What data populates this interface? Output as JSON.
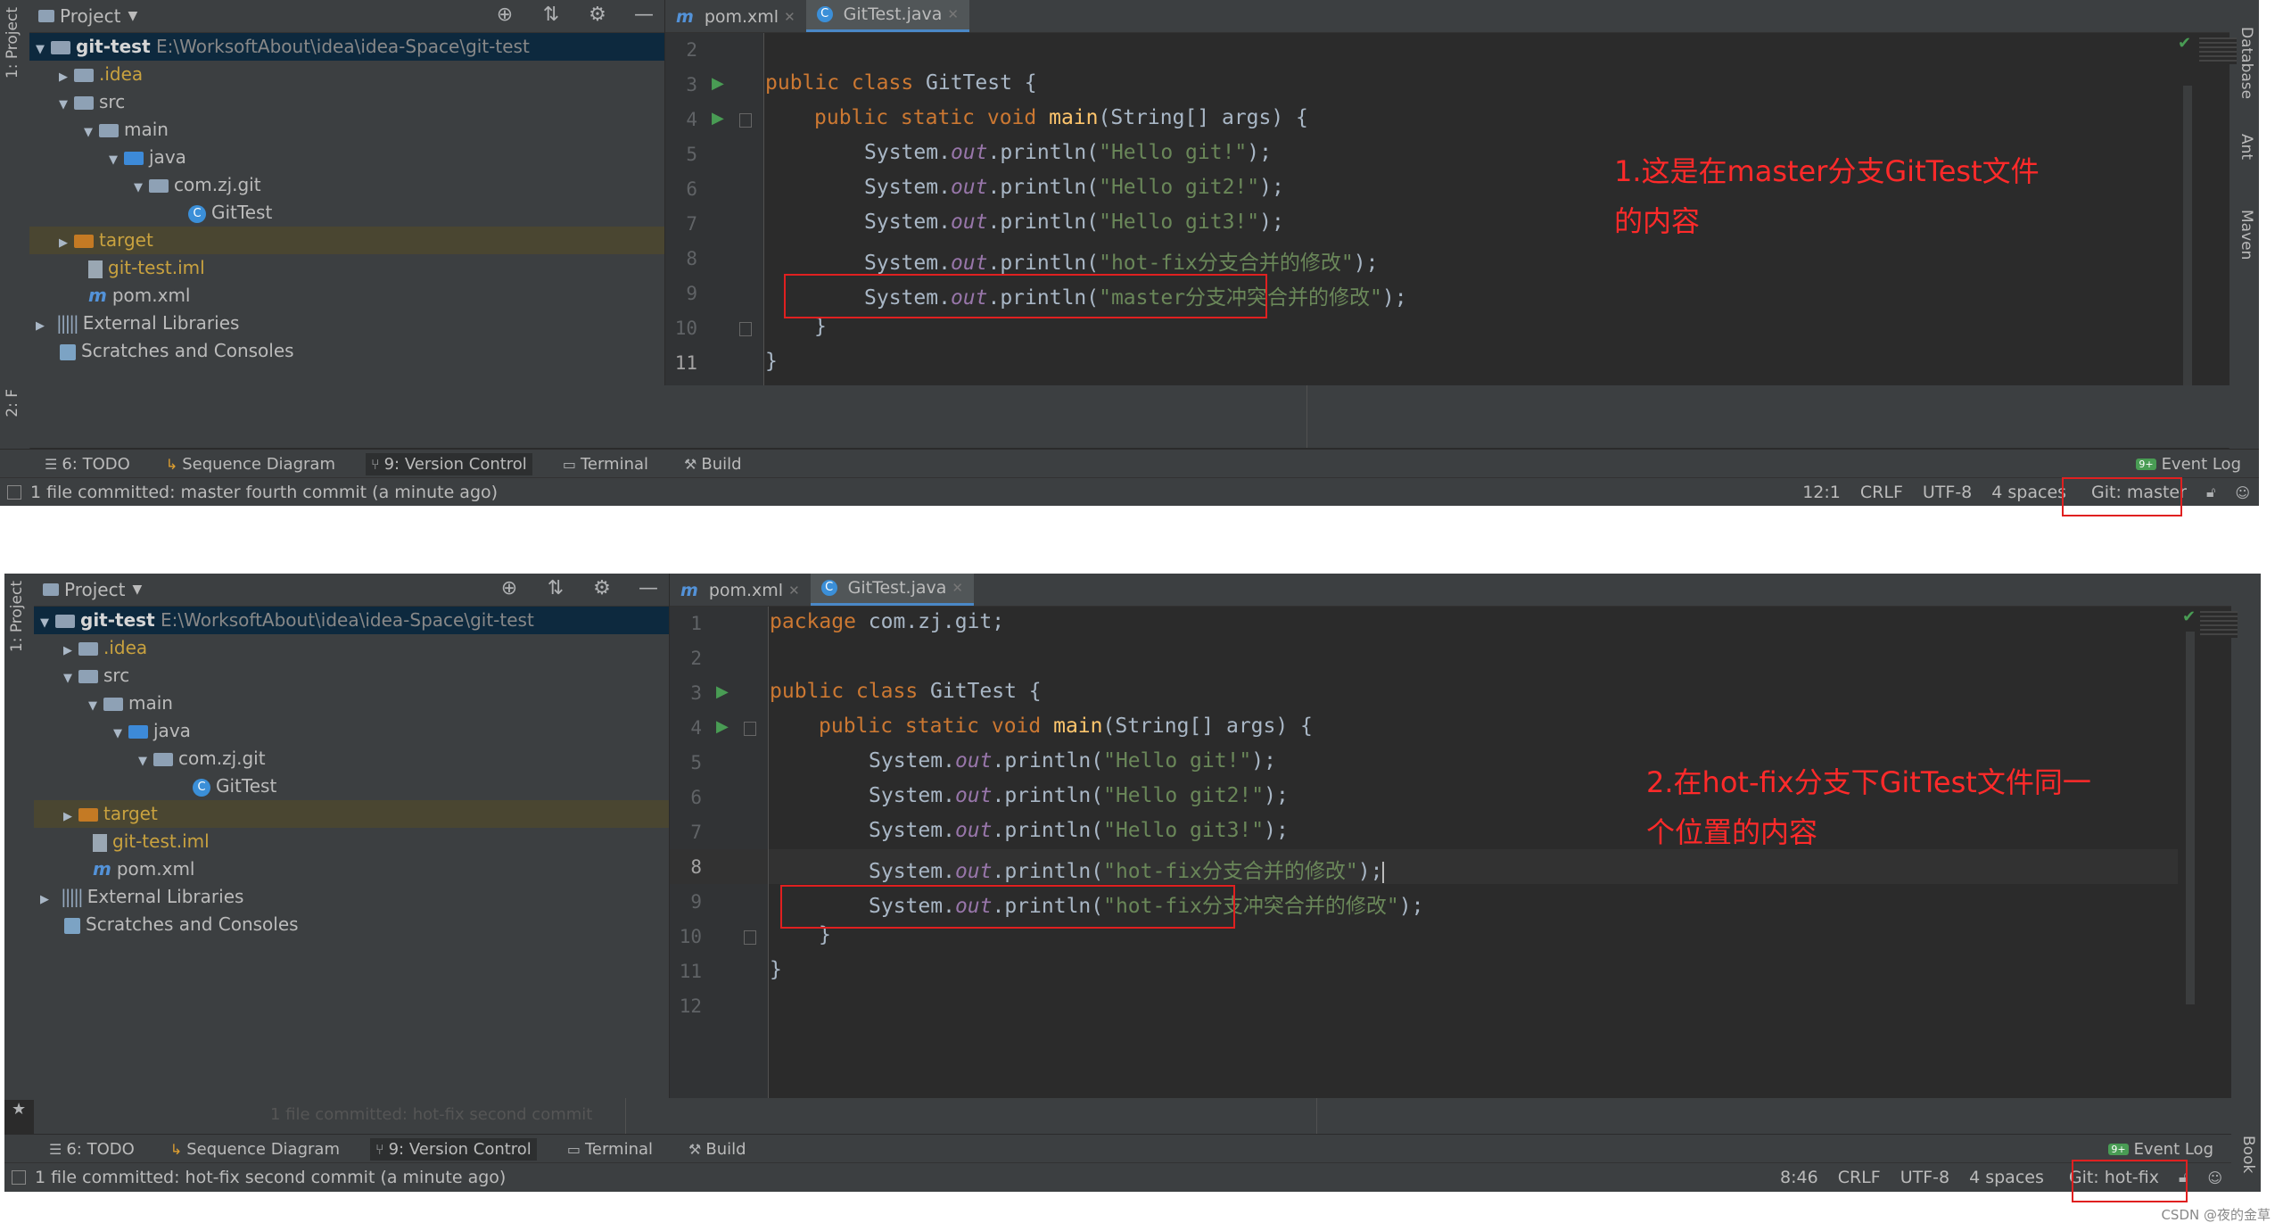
{
  "panels": [
    {
      "project_title": "Project",
      "tree": {
        "root_name": "git-test",
        "root_path": "E:\\WorksoftAbout\\idea\\idea-Space\\git-test",
        "idea": ".idea",
        "src": "src",
        "main": "main",
        "java": "java",
        "package": "com.zj.git",
        "class": "GitTest",
        "target": "target",
        "iml": "git-test.iml",
        "pom": "pom.xml",
        "ext_libs": "External Libraries",
        "scratches": "Scratches and Consoles"
      },
      "tabs": [
        "pom.xml",
        "GitTest.java"
      ],
      "line_numbers": [
        "2",
        "3",
        "4",
        "5",
        "6",
        "7",
        "8",
        "9",
        "10",
        "11"
      ],
      "code": {
        "class_decl": [
          "public class ",
          "GitTest {"
        ],
        "main_decl": [
          "public static void ",
          "main",
          "(String[] args) {"
        ],
        "sys_prefix": "System.",
        "out": "out",
        "println_open": ".println(",
        "println_close": ");",
        "strings": [
          "\"Hello git!\"",
          "\"Hello git2!\"",
          "\"Hello git3!\"",
          "\"hot-fix分支合并的修改\"",
          "\"master分支冲突合并的修改\""
        ],
        "close_brace": "}"
      },
      "annotation": "1.这是在master分支GitTest文件\n的内容",
      "left_stripe_labels": [
        "1: Project",
        "2: F"
      ],
      "right_stripe_labels": [
        "Database",
        "Ant",
        "Maven"
      ],
      "tool_windows": [
        "6: TODO",
        "Sequence Diagram",
        "9: Version Control",
        "Terminal",
        "Build"
      ],
      "event_log": "Event Log",
      "event_badge": "9+",
      "status_message": "1 file committed: master fourth commit (a minute ago)",
      "status_right": [
        "12:1",
        "CRLF",
        "UTF-8",
        "4 spaces"
      ],
      "git_branch": "Git: master"
    },
    {
      "project_title": "Project",
      "tree": {
        "root_name": "git-test",
        "root_path": "E:\\WorksoftAbout\\idea\\idea-Space\\git-test",
        "idea": ".idea",
        "src": "src",
        "main": "main",
        "java": "java",
        "package": "com.zj.git",
        "class": "GitTest",
        "target": "target",
        "iml": "git-test.iml",
        "pom": "pom.xml",
        "ext_libs": "External Libraries",
        "scratches": "Scratches and Consoles"
      },
      "tabs": [
        "pom.xml",
        "GitTest.java"
      ],
      "line_numbers": [
        "1",
        "2",
        "3",
        "4",
        "5",
        "6",
        "7",
        "8",
        "9",
        "10",
        "11",
        "12"
      ],
      "code": {
        "package_line": [
          "package ",
          "com.zj.git;"
        ],
        "class_decl": [
          "public class ",
          "GitTest {"
        ],
        "main_decl": [
          "public static void ",
          "main",
          "(String[] args) {"
        ],
        "sys_prefix": "System.",
        "out": "out",
        "println_open": ".println(",
        "println_close": ");",
        "strings": [
          "\"Hello git!\"",
          "\"Hello git2!\"",
          "\"Hello git3!\"",
          "\"hot-fix分支合并的修改\"",
          "\"hot-fix分支冲突合并的修改\""
        ],
        "close_brace": "}"
      },
      "annotation": "2.在hot-fix分支下GitTest文件同一\n个位置的内容",
      "left_stripe_labels": [
        "1: Project"
      ],
      "right_stripe_labels": [
        "Database",
        "Ant",
        "Maven",
        "Book"
      ],
      "ghost_text": "1 file committed: hot-fix second commit",
      "tool_windows": [
        "6: TODO",
        "Sequence Diagram",
        "9: Version Control",
        "Terminal",
        "Build"
      ],
      "event_log": "Event Log",
      "event_badge": "9+",
      "status_message": "1 file committed: hot-fix second commit (a minute ago)",
      "status_right": [
        "8:46",
        "CRLF",
        "UTF-8",
        "4 spaces"
      ],
      "git_branch": "Git: hot-fix"
    }
  ],
  "watermark": "CSDN @夜的金草",
  "colors": {
    "keyword": "#cc7832",
    "string": "#6a8759",
    "method": "#ffc66d",
    "field": "#9876aa",
    "annotation": "#ff2a2a",
    "highlight_box": "#e02020"
  }
}
